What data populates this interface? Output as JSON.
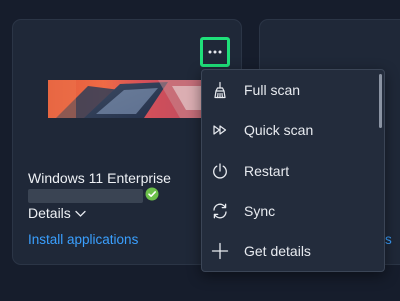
{
  "device_card": {
    "name": "Windows 11 Enterprise",
    "details_label": "Details",
    "install_label": "Install applications"
  },
  "next_card": {
    "link_fragment": "ons"
  },
  "context_menu": {
    "items": [
      {
        "label": "Full scan",
        "icon": "broom-icon"
      },
      {
        "label": "Quick scan",
        "icon": "fast-forward-icon"
      },
      {
        "label": "Restart",
        "icon": "power-icon"
      },
      {
        "label": "Sync",
        "icon": "sync-icon"
      },
      {
        "label": "Get details",
        "icon": "plus-icon"
      }
    ]
  },
  "colors": {
    "background": "#161d2c",
    "card": "#1f2838",
    "menu": "#232c3c",
    "link": "#3aa0ff",
    "focus_ring": "#1fe07a",
    "status_ok": "#6cc04a"
  }
}
